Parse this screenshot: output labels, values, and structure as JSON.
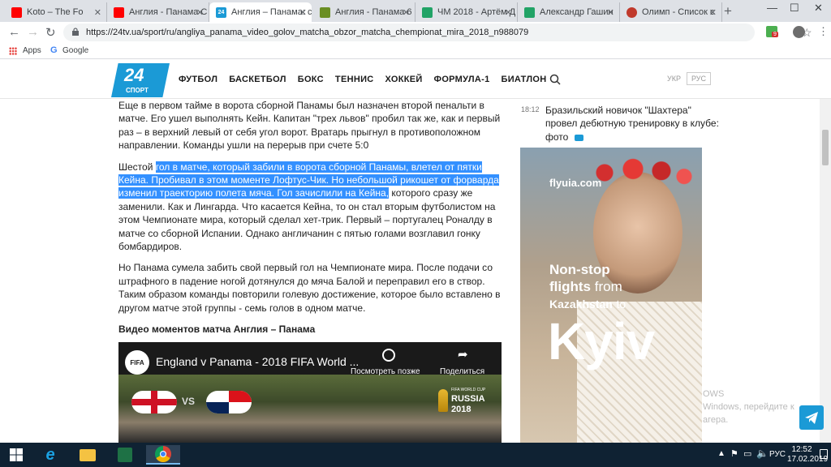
{
  "browser": {
    "tabs": [
      {
        "title": "Koto – The Fo",
        "fav_color": "#ff0000"
      },
      {
        "title": "Англия - Панама С",
        "fav_color": "#ff0000"
      },
      {
        "title": "Англия – Панама: с",
        "fav_color": "#1b9ad6",
        "active": true
      },
      {
        "title": "Англия - Панама 6",
        "fav_color": "#6a8e23"
      },
      {
        "title": "ЧМ 2018 - Артём Д",
        "fav_color": "#21a366"
      },
      {
        "title": "Александр Гашин",
        "fav_color": "#21a366"
      },
      {
        "title": "Олимп - Список с",
        "fav_color": "#c0392b"
      }
    ],
    "url": "https://24tv.ua/sport/ru/angliya_panama_video_golov_matcha_obzor_matcha_chempionat_mira_2018_n988079",
    "bookmarks": [
      "Apps",
      "Google"
    ],
    "ext_badge": "9"
  },
  "site": {
    "logo_number": "24",
    "logo_sub": "СПОРТ",
    "menu": [
      "ФУТБОЛ",
      "БАСКЕТБОЛ",
      "БОКС",
      "ТЕННИС",
      "ХОККЕЙ",
      "ФОРМУЛА-1",
      "БИАТЛОН"
    ],
    "lang_ukr": "УКР",
    "lang_rus": "РУС"
  },
  "article": {
    "p1": "Еще в первом тайме в ворота сборной Панамы был назначен второй пенальти в матче. Его ушел выполнять Кейн. Капитан \"трех львов\" пробил так же, как и первый раз – в верхний левый от себя угол ворот. Вратарь прыгнул в противоположном направлении. Команды ушли на перерыв при счете 5:0",
    "p2_start": "Шестой ",
    "p2_highlight": "гол в матче, который забили в ворота сборной Панамы, влетел от пятки Кейна. Пробивал в этом моменте Лофтус-Чик. Но небольшой рикошет от форварда изменил траекторию полета мяча. Гол зачислили на Кейна,",
    "p2_end": " которого сразу же заменили. Как и Лингарда. Что касается Кейна, то он стал вторым футболистом на этом Чемпионате мира, который сделал хет-трик. Первый – португалец Роналду в матче со сборной Испании. Однако англичанин с пятью голами возглавил гонку бомбардиров.",
    "p3": "Но Панама сумела забить свой первый гол на Чемпионате мира. После подачи со штрафного в падение ногой дотянулся до мяча Балой и переправил его в створ. Таким образом команды повторили голевую достижение, которое было вставлено в другом матче этой группы - семь голов в одном матче.",
    "video_heading": "Видео моментов матча Англия – Панама"
  },
  "video": {
    "channel": "FIFA",
    "title": "England v Panama - 2018 FIFA World ...",
    "watch_later": "Посмотреть позже",
    "share": "Поделиться",
    "vs": "VS",
    "badge_small": "FIFA WORLD CUP",
    "badge_country": "RUSSIA",
    "badge_year": "2018"
  },
  "sidebar": {
    "news_time": "18:12",
    "news_text": "Бразильский новичок \"Шахтера\" провел дебютную тренировку в клубе: фото"
  },
  "ad": {
    "brand": "flyuia.com",
    "line1": "Non-stop",
    "line2a": "flights",
    "line2b": "from",
    "line3a": "Kazakhstan",
    "line3b": "to",
    "city": "Kyiv"
  },
  "watermark": {
    "line1": "OWS",
    "line2": "Windows, перейдите к",
    "line3": "агера."
  },
  "taskbar": {
    "lang": "РУС",
    "time": "12:52",
    "date": "17.02.2019"
  },
  "colors": {
    "accent": "#1b9ad6",
    "selection": "#3390ff",
    "taskbar": "#0f2233"
  }
}
